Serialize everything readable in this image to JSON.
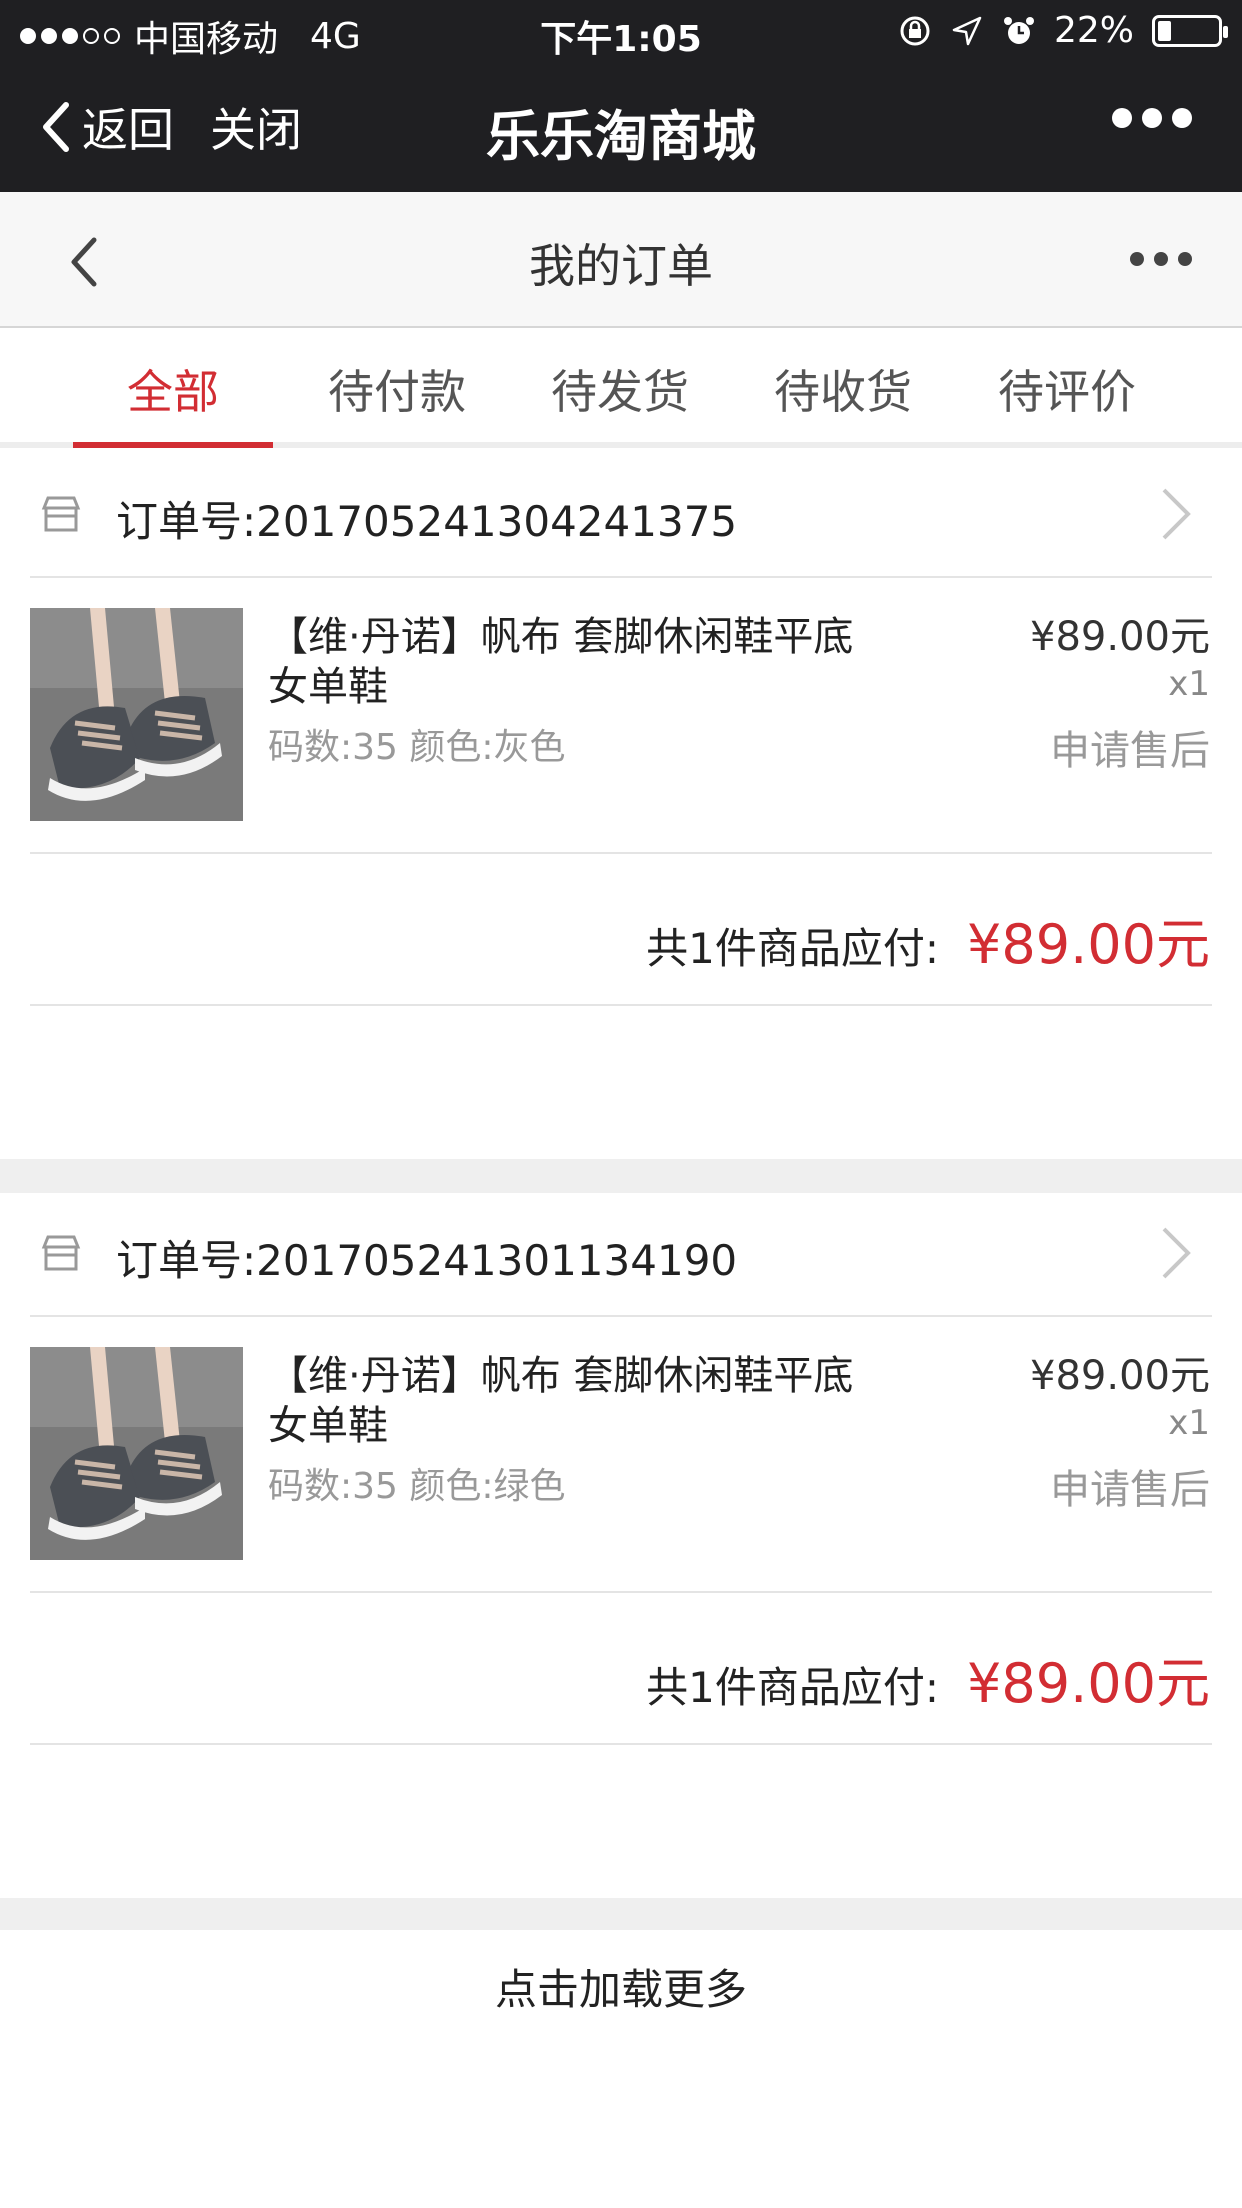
{
  "status_bar": {
    "carrier": "中国移动",
    "network": "4G",
    "time": "下午1:05",
    "battery_percent": "22%",
    "battery_level": 0.22
  },
  "wechat_bar": {
    "back_label": "返回",
    "close_label": "关闭",
    "title": "乐乐淘商城"
  },
  "page_header": {
    "title": "我的订单"
  },
  "tabs": [
    {
      "label": "全部",
      "active": true
    },
    {
      "label": "待付款",
      "active": false
    },
    {
      "label": "待发货",
      "active": false
    },
    {
      "label": "待收货",
      "active": false
    },
    {
      "label": "待评价",
      "active": false
    }
  ],
  "orders": [
    {
      "order_no": "订单号:201705241304241375",
      "product_name": "【维·丹诺】帆布 套脚休闲鞋平底女单鞋",
      "spec": "码数:35 颜色:灰色",
      "price": "¥89.00元",
      "qty": "x1",
      "after_sale": "申请售后",
      "summary_label": "共1件商品应付:",
      "summary_amount": "¥89.00元"
    },
    {
      "order_no": "订单号:201705241301134190",
      "product_name": "【维·丹诺】帆布 套脚休闲鞋平底女单鞋",
      "spec": "码数:35 颜色:绿色",
      "price": "¥89.00元",
      "qty": "x1",
      "after_sale": "申请售后",
      "summary_label": "共1件商品应付:",
      "summary_amount": "¥89.00元"
    }
  ],
  "load_more": "点击加载更多",
  "colors": {
    "accent": "#d22d33",
    "header_bg": "#1f1f22"
  }
}
